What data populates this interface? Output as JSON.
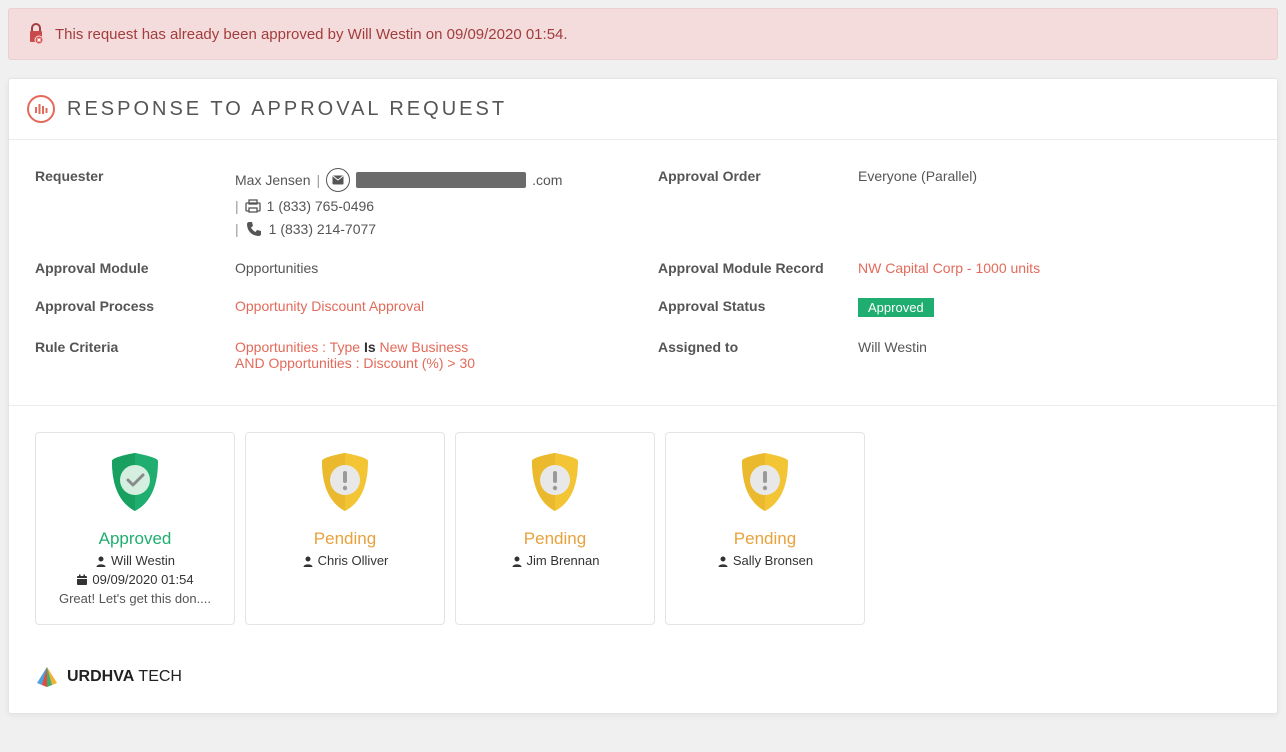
{
  "alert": {
    "message": "This request has already been approved by Will Westin on 09/09/2020 01:54."
  },
  "header": {
    "title": "RESPONSE TO APPROVAL REQUEST"
  },
  "fields": {
    "requester_label": "Requester",
    "requester_name": "Max Jensen",
    "requester_email_suffix": ".com",
    "requester_fax": "1 (833) 765-0496",
    "requester_phone": "1 (833) 214-7077",
    "approval_order_label": "Approval Order",
    "approval_order_value": "Everyone (Parallel)",
    "approval_module_label": "Approval Module",
    "approval_module_value": "Opportunities",
    "approval_module_record_label": "Approval Module Record",
    "approval_module_record_value": "NW Capital Corp - 1000 units",
    "approval_process_label": "Approval Process",
    "approval_process_value": "Opportunity Discount Approval",
    "approval_status_label": "Approval Status",
    "approval_status_value": "Approved",
    "rule_criteria_label": "Rule Criteria",
    "rule": {
      "p1": "Opportunities : Type",
      "is": "Is",
      "p2": "New Business",
      "and": "AND",
      "p3": "Opportunities : Discount (%)",
      "gt": ">",
      "p4": "30"
    },
    "assigned_to_label": "Assigned to",
    "assigned_to_value": "Will Westin"
  },
  "approvers": [
    {
      "status": "Approved",
      "status_class": "approved",
      "name": "Will Westin",
      "date": "09/09/2020 01:54",
      "comment": "Great! Let's get this don...."
    },
    {
      "status": "Pending",
      "status_class": "pending",
      "name": "Chris Olliver"
    },
    {
      "status": "Pending",
      "status_class": "pending",
      "name": "Jim Brennan"
    },
    {
      "status": "Pending",
      "status_class": "pending",
      "name": "Sally Bronsen"
    }
  ],
  "footer": {
    "brand_bold": "URDHVA",
    "brand_light": " TECH"
  }
}
